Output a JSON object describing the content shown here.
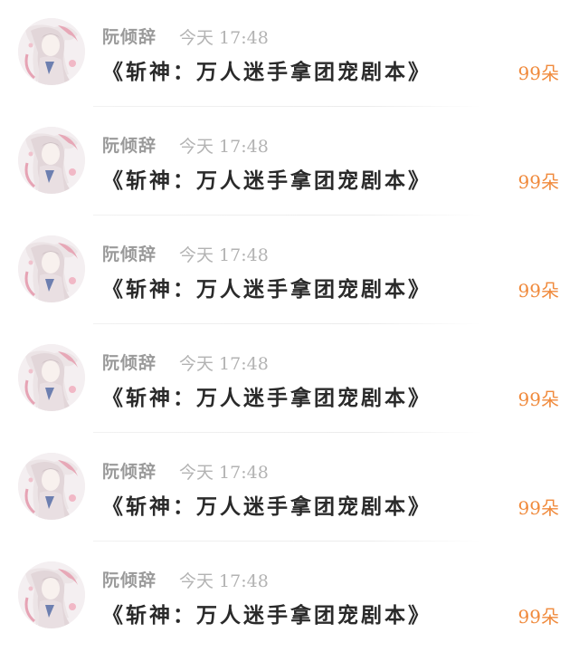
{
  "gifts_list": {
    "items": [
      {
        "sender": "阮倾辞",
        "time": "今天 17:48",
        "message": "《斩神：万人迷手拿团宠剧本》",
        "gift": "99朵",
        "avatar": "character-avatar-icon"
      },
      {
        "sender": "阮倾辞",
        "time": "今天 17:48",
        "message": "《斩神：万人迷手拿团宠剧本》",
        "gift": "99朵",
        "avatar": "character-avatar-icon"
      },
      {
        "sender": "阮倾辞",
        "time": "今天 17:48",
        "message": "《斩神：万人迷手拿团宠剧本》",
        "gift": "99朵",
        "avatar": "character-avatar-icon"
      },
      {
        "sender": "阮倾辞",
        "time": "今天 17:48",
        "message": "《斩神：万人迷手拿团宠剧本》",
        "gift": "99朵",
        "avatar": "character-avatar-icon"
      },
      {
        "sender": "阮倾辞",
        "time": "今天 17:48",
        "message": "《斩神：万人迷手拿团宠剧本》",
        "gift": "99朵",
        "avatar": "character-avatar-icon"
      },
      {
        "sender": "阮倾辞",
        "time": "今天 17:48",
        "message": "《斩神：万人迷手拿团宠剧本》",
        "gift": "99朵",
        "avatar": "character-avatar-icon"
      }
    ]
  },
  "colors": {
    "gift_accent": "#f08a3c",
    "sender_text": "#9a9a9a",
    "time_text": "#b3b3b3",
    "message_text": "#2a2a2a"
  }
}
